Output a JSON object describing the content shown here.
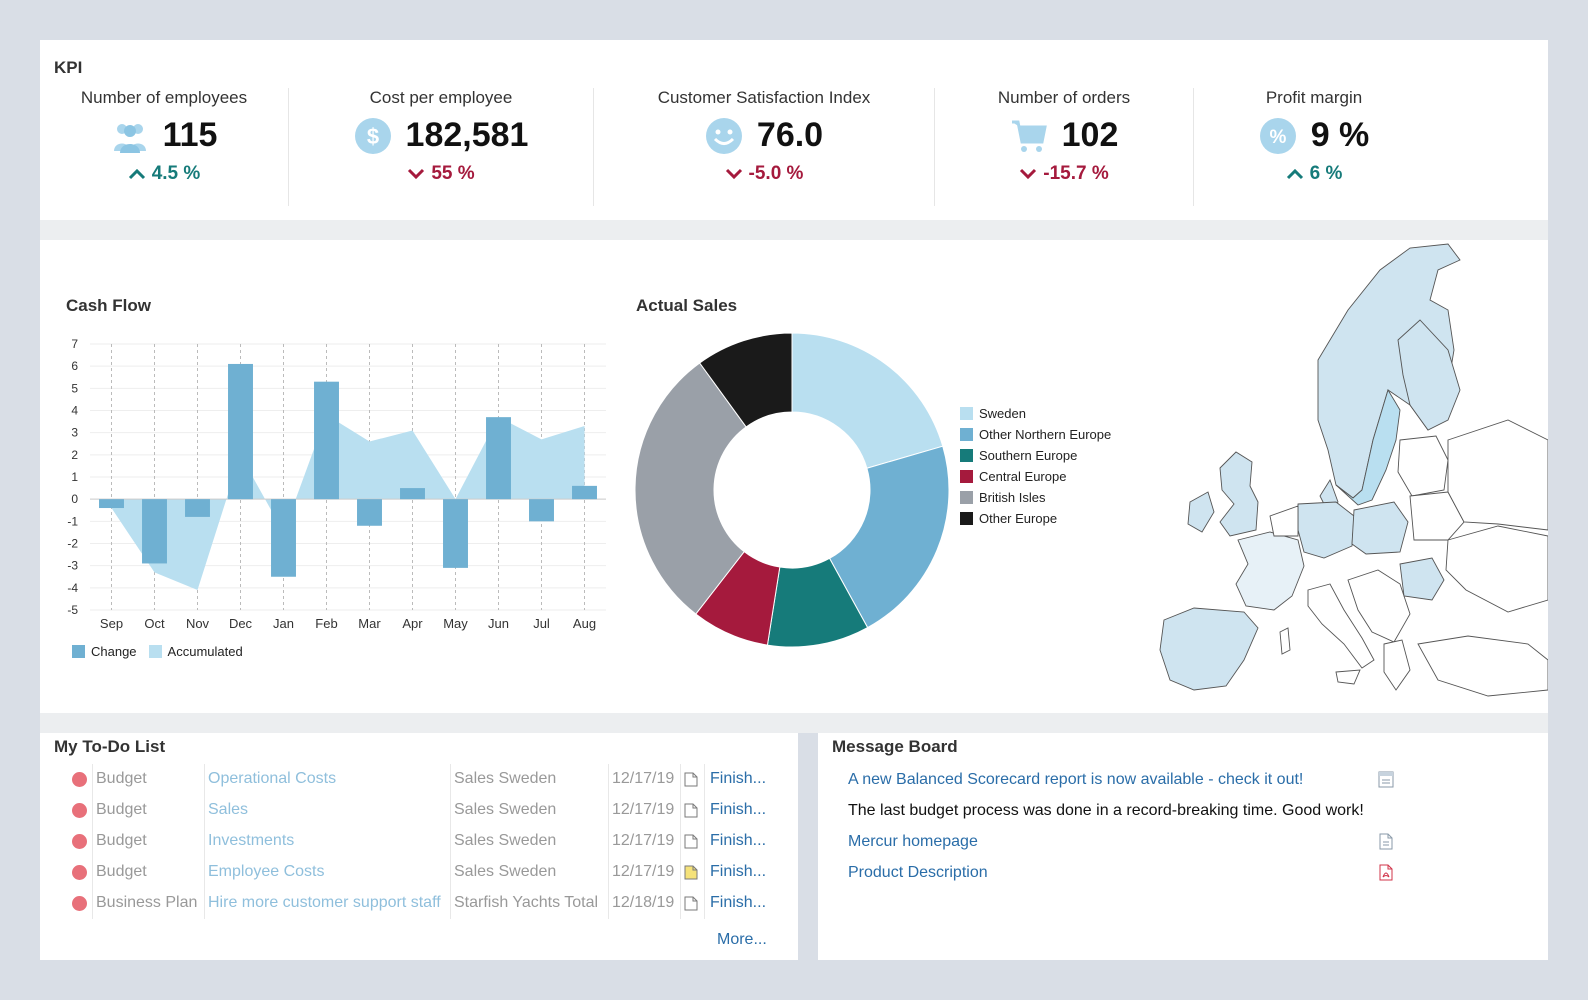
{
  "kpi": {
    "title": "KPI",
    "cards": [
      {
        "label": "Number of employees",
        "value": "115",
        "change": "4.5 %",
        "direction": "up",
        "icon": "people-icon"
      },
      {
        "label": "Cost per employee",
        "value": "182,581",
        "change": "55 %",
        "direction": "down",
        "icon": "dollar-icon"
      },
      {
        "label": "Customer Satisfaction Index",
        "value": "76.0",
        "change": "-5.0 %",
        "direction": "down",
        "icon": "smiley-icon"
      },
      {
        "label": "Number of orders",
        "value": "102",
        "change": "-15.7 %",
        "direction": "down",
        "icon": "cart-icon"
      },
      {
        "label": "Profit margin",
        "value": "9 %",
        "change": "6 %",
        "direction": "up",
        "icon": "percent-icon"
      }
    ]
  },
  "colors": {
    "teal_up": "#167b7a",
    "red_down": "#a51a3d",
    "bar_blue": "#6fb0d2",
    "area_blue": "#b9dff0",
    "sweden": "#b9dff0",
    "other_northern_europe": "#6fb0d2",
    "southern_europe": "#167b7a",
    "central_europe": "#a51a3d",
    "british_isles": "#9aa0a8",
    "other_europe": "#1a1a1a"
  },
  "cash_flow": {
    "title": "Cash Flow"
  },
  "actual_sales": {
    "title": "Actual Sales"
  },
  "chart_data": [
    {
      "type": "bar",
      "title": "Cash Flow",
      "categories": [
        "Sep",
        "Oct",
        "Nov",
        "Dec",
        "Jan",
        "Feb",
        "Mar",
        "Apr",
        "May",
        "Jun",
        "Jul",
        "Aug"
      ],
      "series": [
        {
          "name": "Change",
          "values": [
            -0.4,
            -2.9,
            -0.8,
            6.1,
            -3.5,
            5.3,
            -1.2,
            0.5,
            -3.1,
            3.7,
            -1.0,
            0.6
          ]
        },
        {
          "name": "Accumulated",
          "values": [
            -0.4,
            -3.3,
            -4.1,
            2.0,
            -1.5,
            3.8,
            2.6,
            3.1,
            0.0,
            3.7,
            2.7,
            3.3
          ]
        }
      ],
      "yticks": [
        7,
        6,
        5,
        4,
        3,
        2,
        1,
        0,
        -1,
        -2,
        -3,
        -4,
        -5
      ],
      "ylim": [
        -5,
        7
      ],
      "xlabel": "",
      "ylabel": "",
      "grid": true,
      "legend": "bottom-left"
    },
    {
      "type": "pie",
      "title": "Actual Sales",
      "labels": [
        "Sweden",
        "Other Northern Europe",
        "Southern Europe",
        "Central Europe",
        "British Isles",
        "Other Europe"
      ],
      "values": [
        20.5,
        21.5,
        10.5,
        8.0,
        29.5,
        10.0
      ],
      "donut": true,
      "legend": "right"
    }
  ],
  "todo": {
    "title": "My To-Do List",
    "rows": [
      {
        "type": "Budget",
        "item": "Operational Costs",
        "unit": "Sales Sweden",
        "date": "12/17/19",
        "action": "Finish...",
        "doc_color": "#ffffff"
      },
      {
        "type": "Budget",
        "item": "Sales",
        "unit": "Sales Sweden",
        "date": "12/17/19",
        "action": "Finish...",
        "doc_color": "#ffffff"
      },
      {
        "type": "Budget",
        "item": "Investments",
        "unit": "Sales Sweden",
        "date": "12/17/19",
        "action": "Finish...",
        "doc_color": "#ffffff"
      },
      {
        "type": "Budget",
        "item": "Employee Costs",
        "unit": "Sales Sweden",
        "date": "12/17/19",
        "action": "Finish...",
        "doc_color": "#f5e27a"
      },
      {
        "type": "Business Plan",
        "item": "Hire more customer support staff",
        "unit": "Starfish Yachts Total",
        "date": "12/18/19",
        "action": "Finish...",
        "doc_color": "#ffffff"
      }
    ],
    "more": "More..."
  },
  "board": {
    "title": "Message Board",
    "messages": [
      {
        "text": "A new Balanced Scorecard report is now available - check it out!",
        "kind": "link",
        "icon": "report-icon"
      },
      {
        "text": "The last budget process was done in a record-breaking time. Good work!",
        "kind": "text",
        "icon": ""
      },
      {
        "text": "Mercur homepage",
        "kind": "link",
        "icon": "document-icon"
      },
      {
        "text": "Product Description",
        "kind": "link",
        "icon": "pdf-icon"
      }
    ]
  }
}
